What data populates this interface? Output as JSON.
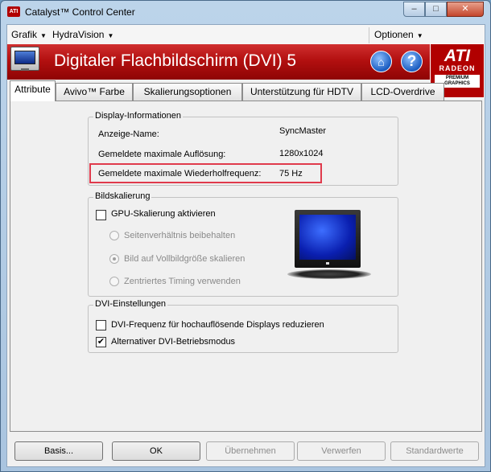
{
  "window": {
    "title": "Catalyst™ Control Center",
    "title_logo": "ATI",
    "min_label": "–",
    "max_label": "□",
    "close_label": "✕"
  },
  "menu": {
    "grafik": "Grafik",
    "hydravision": "HydraVision",
    "optionen": "Optionen"
  },
  "header": {
    "title": "Digitaler Flachbildschirm (DVI) 5",
    "home_icon": "⌂",
    "help_icon": "?"
  },
  "logo": {
    "ati": "ATI",
    "radeon": "RADEON",
    "premium": "PREMIUM",
    "graphics": "GRAPHICS"
  },
  "tabs": [
    {
      "label": "Attribute"
    },
    {
      "label": "Avivo™ Farbe"
    },
    {
      "label": "Skalierungsoptionen"
    },
    {
      "label": "Unterstützung für HDTV"
    },
    {
      "label": "LCD-Overdrive"
    }
  ],
  "display_info": {
    "group_label": "Display-Informationen",
    "rows": [
      {
        "label": "Anzeige-Name:",
        "value": "SyncMaster"
      },
      {
        "label": "Gemeldete maximale Auflösung:",
        "value": "1280x1024"
      },
      {
        "label": "Gemeldete maximale Wiederholfrequenz:",
        "value": "75 Hz"
      }
    ]
  },
  "scaling": {
    "group_label": "Bildskalierung",
    "gpu_checkbox": "GPU-Skalierung aktivieren",
    "gpu_checked": false,
    "radios": [
      {
        "label": "Seitenverhältnis beibehalten",
        "selected": false
      },
      {
        "label": "Bild auf Vollbildgröße skalieren",
        "selected": true
      },
      {
        "label": "Zentriertes Timing verwenden",
        "selected": false
      }
    ]
  },
  "dvi": {
    "group_label": "DVI-Einstellungen",
    "options": [
      {
        "label": "DVI-Frequenz für hochauflösende Displays reduzieren",
        "checked": false
      },
      {
        "label": "Alternativer DVI-Betriebsmodus",
        "checked": true
      }
    ],
    "check_mark": "✔"
  },
  "buttons": {
    "basis": "Basis...",
    "ok": "OK",
    "apply": "Übernehmen",
    "discard": "Verwerfen",
    "defaults": "Standardwerte"
  },
  "colors": {
    "header_red": "#b31010",
    "highlight": "#e03a4c"
  }
}
